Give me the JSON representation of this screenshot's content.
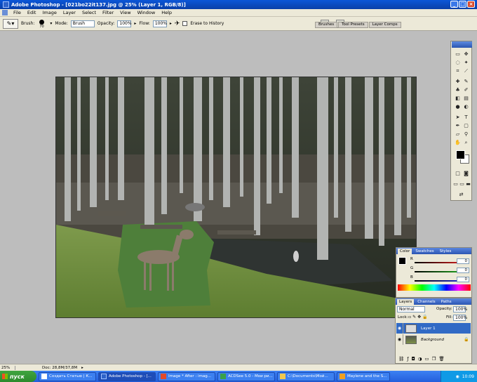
{
  "window": {
    "title": "Adobe Photoshop - [021bo22it137.jpg @ 25% (Layer 1, RGB/8)]"
  },
  "menu": [
    "File",
    "Edit",
    "Image",
    "Layer",
    "Select",
    "Filter",
    "View",
    "Window",
    "Help"
  ],
  "options": {
    "brush_label": "Brush:",
    "brush_size": "70",
    "mode_label": "Mode:",
    "mode_value": "Brush",
    "opacity_label": "Opacity:",
    "opacity_value": "100%",
    "flow_label": "Flow:",
    "flow_value": "100%",
    "erase_history_label": "Erase to History"
  },
  "wells": [
    "Brushes",
    "Tool Presets",
    "Layer Comps"
  ],
  "color_panel": {
    "tabs": [
      "Color",
      "Swatches",
      "Styles"
    ],
    "sliders": [
      {
        "label": "R",
        "value": "0",
        "color": "#e02020"
      },
      {
        "label": "G",
        "value": "0",
        "color": "#20b020"
      },
      {
        "label": "B",
        "value": "0",
        "color": "#2030e0"
      }
    ]
  },
  "layers_panel": {
    "tabs": [
      "Layers",
      "Channels",
      "Paths"
    ],
    "blend_mode": "Normal",
    "opacity_label": "Opacity:",
    "opacity_value": "100%",
    "lock_label": "Lock:",
    "fill_label": "Fill:",
    "fill_value": "100%",
    "layers": [
      {
        "name": "Layer 1",
        "selected": true
      },
      {
        "name": "Background",
        "selected": false
      }
    ]
  },
  "status": {
    "zoom": "25%",
    "doc": "Doc: 28,8M/37,8M"
  },
  "taskbar": {
    "start_label": "пуск",
    "tasks": [
      "Создать Статью | К...",
      "Adobe Photoshop - [...",
      "Image * After : imag...",
      "ACDSee 5.0 - Мои ри...",
      "C:\\Documents\\Мой...",
      "Maylene and the S..."
    ],
    "active_task": 1,
    "clock": "10:09"
  }
}
